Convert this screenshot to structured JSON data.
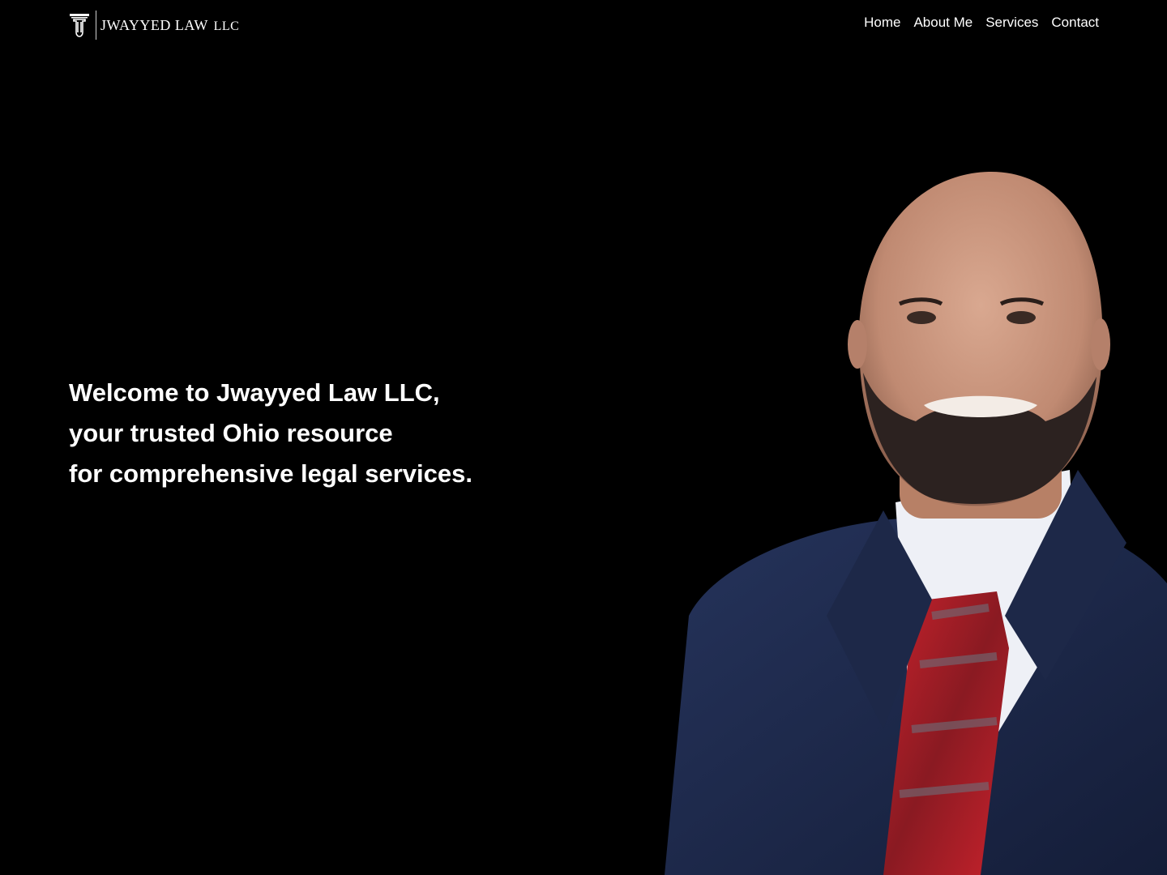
{
  "brand": {
    "name": "JWAYYED LAW",
    "suffix": "LLC",
    "logo_icon": "pillar-monogram-icon"
  },
  "nav": {
    "items": [
      {
        "label": "Home"
      },
      {
        "label": "About Me"
      },
      {
        "label": "Services"
      },
      {
        "label": "Contact"
      }
    ]
  },
  "hero": {
    "headline_lines": [
      "Welcome to Jwayyed Law LLC,",
      "your trusted Ohio resource",
      "for comprehensive legal services."
    ]
  },
  "colors": {
    "background": "#000000",
    "text": "#ffffff",
    "suit": "#1c2a4f",
    "tie_red": "#b3202a"
  }
}
